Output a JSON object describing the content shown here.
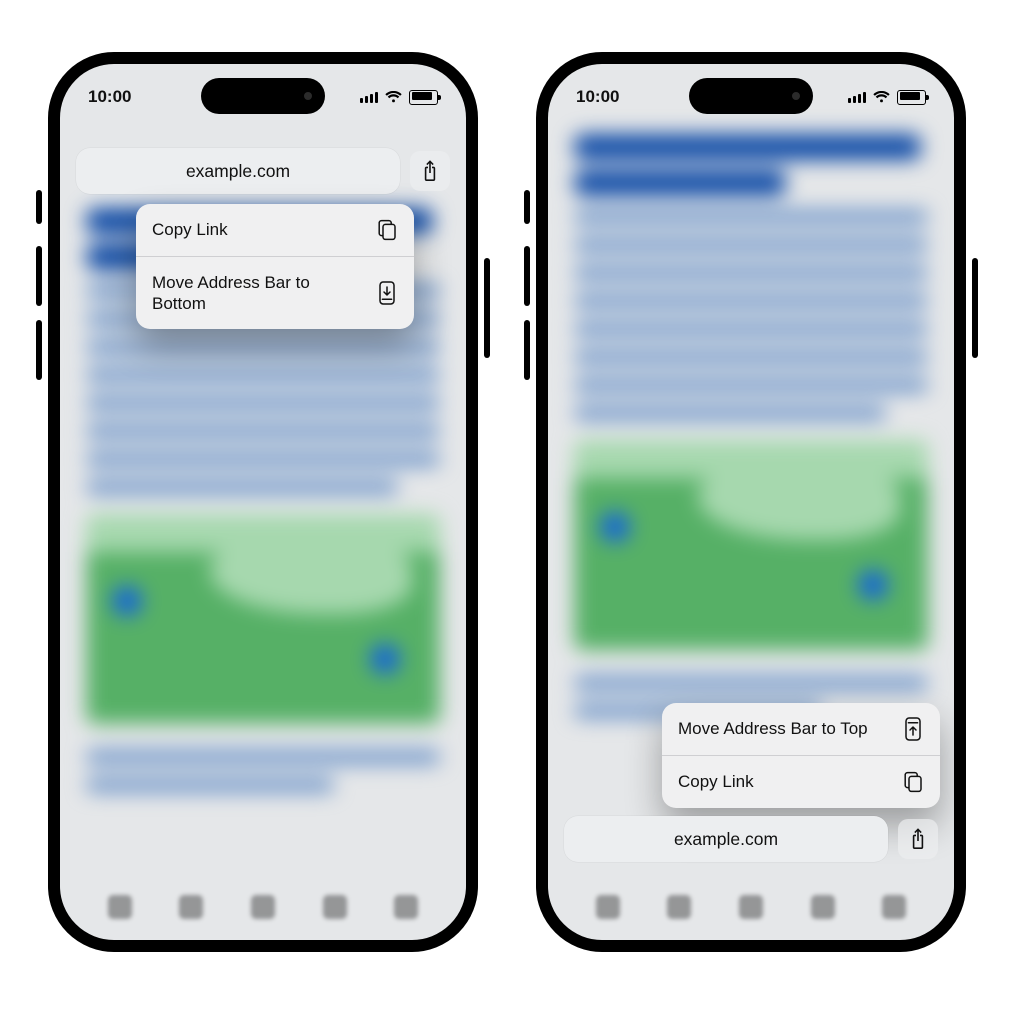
{
  "status": {
    "time": "10:00"
  },
  "address": {
    "url": "example.com"
  },
  "left_phone": {
    "menu": {
      "copy_link": "Copy Link",
      "move_to_bottom": "Move Address Bar to Bottom"
    }
  },
  "right_phone": {
    "menu": {
      "move_to_top": "Move Address Bar to Top",
      "copy_link": "Copy Link"
    }
  },
  "icons": {
    "share": "share-icon",
    "copy": "copy-icon",
    "move_down": "move-to-bottom-icon",
    "move_up": "move-to-top-icon",
    "cellular": "cellular-icon",
    "wifi": "wifi-icon",
    "battery": "battery-icon"
  }
}
